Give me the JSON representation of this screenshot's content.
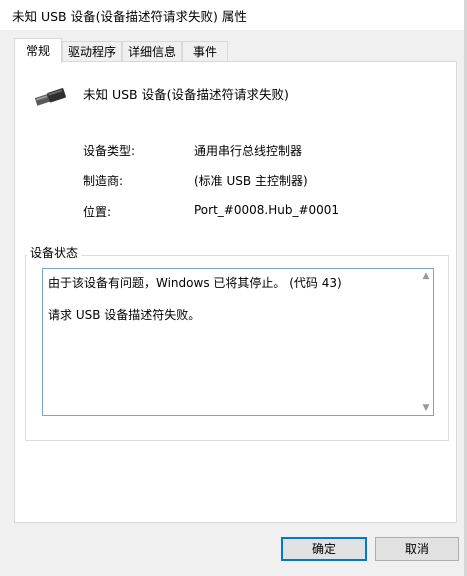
{
  "window": {
    "title": "未知 USB 设备(设备描述符请求失败) 属性"
  },
  "tabs": [
    {
      "label": "常规"
    },
    {
      "label": "驱动程序"
    },
    {
      "label": "详细信息"
    },
    {
      "label": "事件"
    }
  ],
  "device": {
    "icon": "usb-plug-icon",
    "name": "未知 USB 设备(设备描述符请求失败)"
  },
  "properties": [
    {
      "label": "设备类型:",
      "value": "通用串行总线控制器"
    },
    {
      "label": "制造商:",
      "value": "(标准 USB 主控制器)"
    },
    {
      "label": "位置:",
      "value": "Port_#0008.Hub_#0001"
    }
  ],
  "status": {
    "group_label": "设备状态",
    "line1": "由于该设备有问题，Windows 已将其停止。 (代码 43)",
    "line2": "请求 USB 设备描述符失败。"
  },
  "buttons": {
    "ok": "确定",
    "cancel": "取消"
  }
}
